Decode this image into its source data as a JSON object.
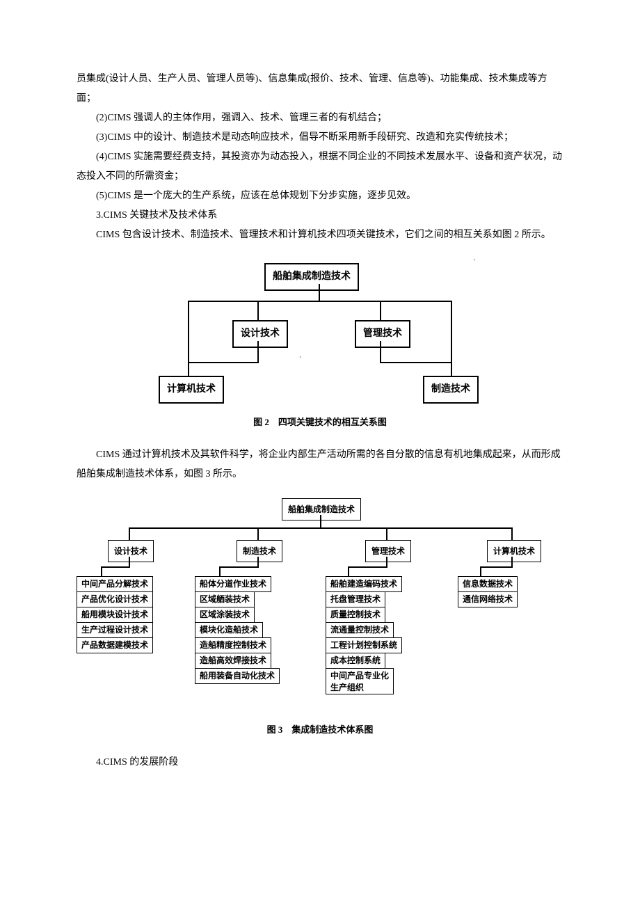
{
  "body": {
    "p1": "员集成(设计人员、生产人员、管理人员等)、信息集成(报价、技术、管理、信息等)、功能集成、技术集成等方面；",
    "p2": "(2)CIMS 强调人的主体作用，强调入、技术、管理三者的有机结合；",
    "p3": "(3)CIMS 中的设计、制造技术是动态响应技术，倡导不断采用新手段研究、改造和充实传统技术；",
    "p4": "(4)CIMS 实施需要经费支持，其投资亦为动态投入，根据不同企业的不同技术发展水平、设备和资产状况，动态投入不同的所需资金；",
    "p5": "(5)CIMS 是一个庞大的生产系统，应该在总体规划下分步实施，逐步见效。",
    "p6": "3.CIMS 关键技术及技术体系",
    "p7": "CIMS 包含设计技术、制造技术、管理技术和计算机技术四项关键技术，它们之间的相互关系如图 2 所示。",
    "p8": "CIMS 通过计算机技术及其软件科学，将企业内部生产活动所需的各自分散的信息有机地集成起来，从而形成船舶集成制造技术体系，如图 3 所示。",
    "p9": "4.CIMS 的发展阶段"
  },
  "diagram1": {
    "caption": "图 2　四项关键技术的相互关系图",
    "root": "船舶集成制造技术",
    "mid_left": "设计技术",
    "mid_right": "管理技术",
    "bot_left": "计算机技术",
    "bot_right": "制造技术"
  },
  "diagram2": {
    "caption": "图 3　集成制造技术体系图",
    "root": "船舶集成制造技术",
    "cat1": "设计技术",
    "cat2": "制造技术",
    "cat3": "管理技术",
    "cat4": "计算机技术",
    "c1_1": "中间产品分解技术",
    "c1_2": "产品优化设计技术",
    "c1_3": "船用模块设计技术",
    "c1_4": "生产过程设计技术",
    "c1_5": "产品数据建模技术",
    "c2_1": "船体分道作业技术",
    "c2_2": "区域舾装技术",
    "c2_3": "区域涂装技术",
    "c2_4": "模块化造船技术",
    "c2_5": "造船精度控制技术",
    "c2_6": "造船高效焊接技术",
    "c2_7": "船用装备自动化技术",
    "c3_1": "船舶建造编码技术",
    "c3_2": "托盘管理技术",
    "c3_3": "质量控制技术",
    "c3_4": "流通量控制技术",
    "c3_5": "工程计划控制系统",
    "c3_6": "成本控制系统",
    "c3_7a": "中间产品专业化",
    "c3_7b": "生产组织",
    "c4_1": "信息数据技术",
    "c4_2": "通信网络技术"
  }
}
